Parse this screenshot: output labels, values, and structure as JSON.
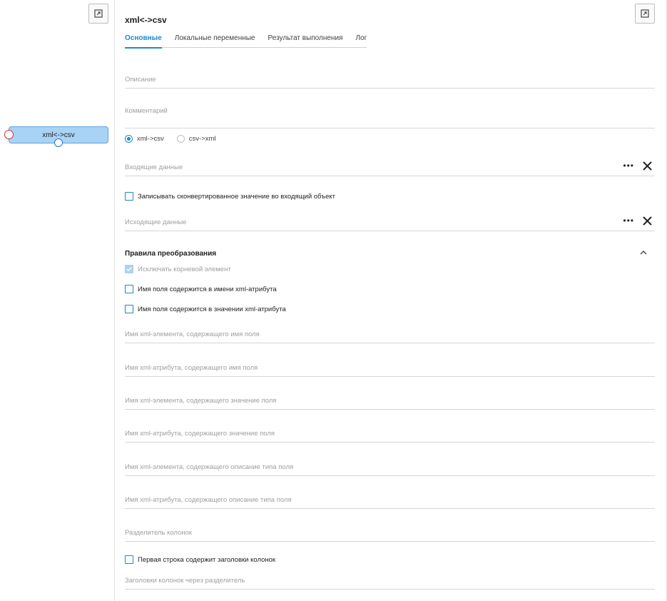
{
  "canvas": {
    "node_label": "xml<->csv"
  },
  "panel": {
    "title": "xml<->csv",
    "tabs": [
      "Основные",
      "Локальные переменные",
      "Результат выполнения",
      "Лог"
    ],
    "description_placeholder": "Описание",
    "comment_placeholder": "Комментарий",
    "direction_options": [
      "xml->csv",
      "csv->xml"
    ],
    "direction_selected": "xml->csv",
    "input_data_placeholder": "Входящие данные",
    "write_back_label": "Записывать сконвертированное значение во входящий объект",
    "output_data_placeholder": "Исходящие данные",
    "rules_title": "Правила преобразования",
    "exclude_root_label": "Исключать корневой элемент",
    "name_in_attr_name_label": "Имя поля содержится в имени xml-атрибута",
    "name_in_attr_value_label": "Имя поля содержится в значении xml-атрибута",
    "fields": [
      "Имя xml-элемента, содержащего имя поля",
      "Имя xml-атрибута, содержащего имя поля",
      "Имя xml-элемента, содержащего значение поля",
      "Имя xml-атрибута, содержащего значение поля",
      "Имя xml-элемента, содержащего описание типа поля",
      "Имя xml-атрибута, содержащего описание типа поля",
      "Разделитель колонок"
    ],
    "first_row_headers_label": "Первая строка содержит заголовки колонок",
    "headers_placeholder": "Заголовки колонок через разделитель"
  },
  "colors": {
    "accent": "#1e88c8",
    "node_fill": "#a9d3f5",
    "port_in": "#d32f2f",
    "port_out": "#1976d2"
  }
}
